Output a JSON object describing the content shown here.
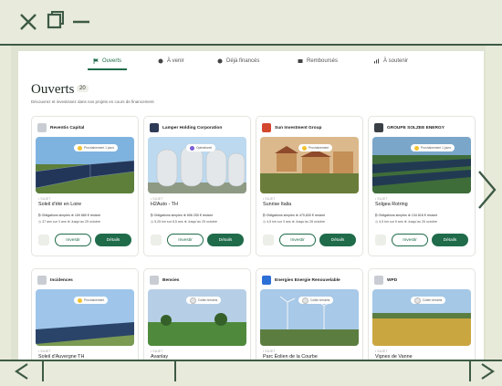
{
  "tabs": [
    {
      "label": "Ouverts",
      "icon": "flag-icon",
      "active": true
    },
    {
      "label": "À venir",
      "icon": "clock-icon",
      "active": false
    },
    {
      "label": "Déjà financés",
      "icon": "check-circle-icon",
      "active": false
    },
    {
      "label": "Remboursés",
      "icon": "folder-icon",
      "active": false
    },
    {
      "label": "À soutenir",
      "icon": "chart-up-icon",
      "active": false
    }
  ],
  "page": {
    "title": "Ouverts",
    "count": "20",
    "subtitle": "Découvrez et investissez dans nos projets en cours de financement"
  },
  "cards": [
    {
      "company": "Reventis Capital",
      "badge": "Prochainement 1 jours",
      "badge_color": "#f2c230",
      "tag": "• SUJET",
      "project": "Soleil d'été en Loire",
      "line1": "₿ Obligations simples  ⊕ 169 880 € restant",
      "line2": "◷ 37 ans sur 3 ans   ⊕ Jusqu'au 25 octobre",
      "scene": "solar",
      "logo_color": "#c9cdd3"
    },
    {
      "company": "Lamper Holding Corporation",
      "badge": "Opérationel",
      "badge_color": "#7b5cd6",
      "tag": "• SUJET",
      "project": "H2Auto - TH",
      "line1": "₿ Obligations simples  ⊕ 696 250 € restant",
      "line2": "◷ 5,25 km sur 8,5 ans   ⊕ Jusqu'au 25 octobre",
      "scene": "tanks",
      "logo_color": "#2f3a56"
    },
    {
      "company": "Sun Investment Group",
      "badge": "Prochainement",
      "badge_color": "#f2c230",
      "tag": "• SUJET",
      "project": "Sunrise Italia",
      "line1": "₿ Obligations simples  ⊕ 470,830 € restant",
      "line2": "◷ 4,5 km sur 3 ans   ⊕ Jusqu'au 28 octobre",
      "scene": "village",
      "logo_color": "#d4472f"
    },
    {
      "company": "GROUPE SOLZEE ENERGY",
      "badge": "Prochainement 1 jours",
      "badge_color": "#f2c230",
      "tag": "• SUJET",
      "project": "Solgea Rotring",
      "line1": "₿ Obligations simples  ⊕ 134 816 € restant",
      "line2": "◷ 4,5 km sur 5 ans   ⊕ Jusqu'au 26 octobre",
      "scene": "field-solar",
      "logo_color": "#3a3f46"
    },
    {
      "company": "Incidences",
      "badge": "Prochainement",
      "badge_color": "#f2c230",
      "tag": "• SUJET",
      "project": "Soleil d'Auvergne TH",
      "line1": "",
      "line2": "",
      "scene": "solar-sky",
      "logo_color": "#c9cdd3"
    },
    {
      "company": "Bensies",
      "badge": "Collen terrains",
      "badge_color": "#e4e4e4",
      "tag": "• SUJET",
      "project": "Avanlay",
      "line1": "",
      "line2": "",
      "scene": "grass",
      "logo_color": "#c9cdd3"
    },
    {
      "company": "Energies Energie Renouvelable",
      "badge": "Collen terrains",
      "badge_color": "#e4e4e4",
      "tag": "• SUJET",
      "project": "Parc Éolien de la Courbe",
      "line1": "",
      "line2": "",
      "scene": "wind",
      "logo_color": "#2c6fd6"
    },
    {
      "company": "WPD",
      "badge": "Collen terrains",
      "badge_color": "#e4e4e4",
      "tag": "• SUJET",
      "project": "Vignes de Vanne",
      "line1": "",
      "line2": "",
      "scene": "wheat",
      "logo_color": "#c9cdd3"
    }
  ],
  "actions": {
    "invest_label": "Investir",
    "details_label": "Détails"
  },
  "colors": {
    "primary": "#1f6b4a",
    "chrome": "#3d5a45",
    "background": "#e7ead9"
  }
}
